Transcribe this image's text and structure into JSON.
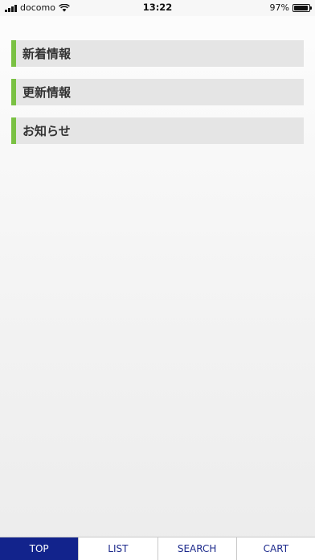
{
  "status_bar": {
    "carrier": "docomo",
    "time": "13:22",
    "battery_percent": "97%",
    "battery_level": 0.97
  },
  "sections": [
    {
      "title": "新着情報"
    },
    {
      "title": "更新情報"
    },
    {
      "title": "お知らせ"
    }
  ],
  "colors": {
    "section_accent": "#7ac143",
    "section_background": "#e5e5e5",
    "tab_active_background": "#12238c",
    "tab_text": "#1d2a8c"
  },
  "tab_bar": {
    "active": "TOP",
    "tabs": [
      {
        "label": "TOP"
      },
      {
        "label": "LIST"
      },
      {
        "label": "SEARCH"
      },
      {
        "label": "CART"
      }
    ]
  }
}
